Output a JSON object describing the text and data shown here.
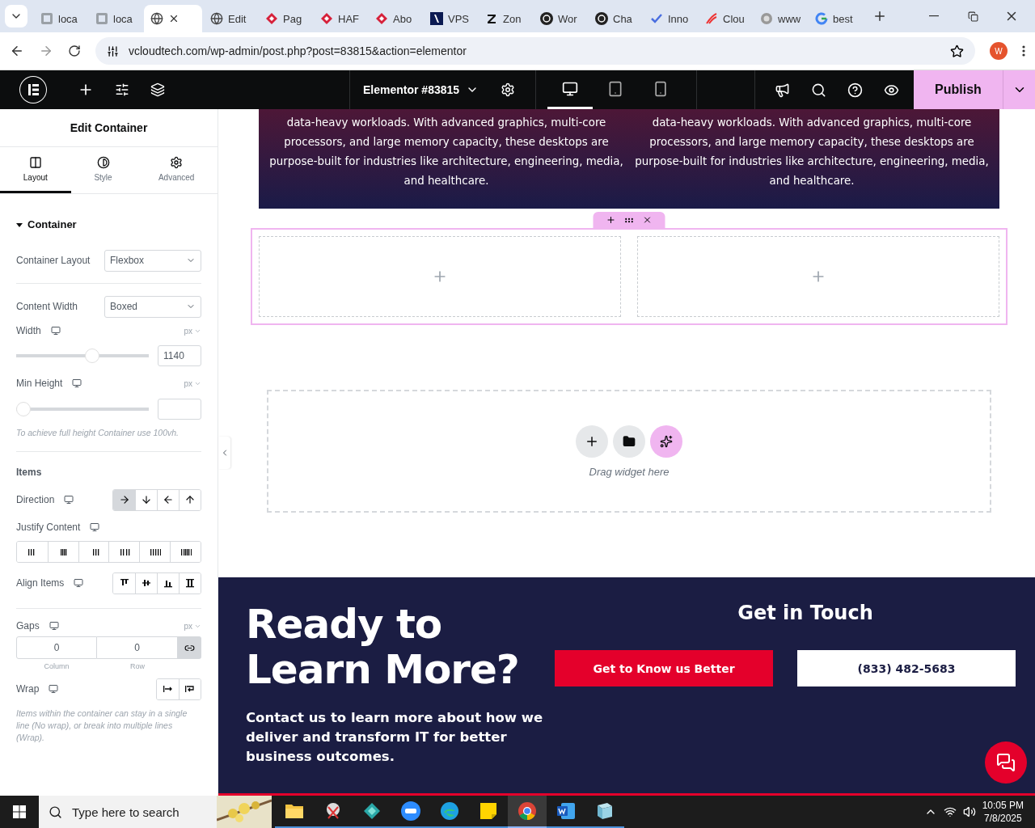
{
  "browser": {
    "tabs": [
      {
        "label": "loca",
        "kind": "page",
        "selected": false
      },
      {
        "label": "loca",
        "kind": "page",
        "selected": false
      },
      {
        "kind": "globe",
        "selected": true
      },
      {
        "label": "Edit",
        "kind": "globe",
        "selected": false
      },
      {
        "label": "Pag",
        "kind": "diamond",
        "selected": false
      },
      {
        "label": "HAF",
        "kind": "diamond",
        "selected": false
      },
      {
        "label": "Abo",
        "kind": "diamond",
        "selected": false
      },
      {
        "label": "VPS",
        "kind": "square",
        "selected": false
      },
      {
        "label": "Zon",
        "kind": "letter",
        "selected": false
      },
      {
        "label": "Wor",
        "kind": "ring",
        "selected": false
      },
      {
        "label": "Cha",
        "kind": "ring",
        "selected": false
      },
      {
        "label": "Inno",
        "kind": "check",
        "selected": false
      },
      {
        "label": "Clou",
        "kind": "swoosh",
        "selected": false
      },
      {
        "label": "www",
        "kind": "dot",
        "selected": false
      },
      {
        "label": "best",
        "kind": "g",
        "selected": false
      }
    ],
    "url": "vcloudtech.com/wp-admin/post.php?post=83815&action=elementor",
    "profile": "W"
  },
  "topbar": {
    "document_title": "Elementor #83815",
    "devices": [
      {
        "kind": "desktop",
        "selected": true
      },
      {
        "kind": "tablet",
        "selected": false
      },
      {
        "kind": "mobile",
        "selected": false
      }
    ],
    "publish": "Publish"
  },
  "panel": {
    "title": "Edit Container",
    "tabs": [
      {
        "label": "Layout",
        "kind": "layout",
        "selected": true
      },
      {
        "label": "Style",
        "kind": "style",
        "selected": false
      },
      {
        "label": "Advanced",
        "kind": "advanced",
        "selected": false
      }
    ],
    "section": {
      "title": "Container",
      "expanded": true
    },
    "container_layout": {
      "label": "Container Layout",
      "value": "Flexbox"
    },
    "content_width": {
      "label": "Content Width",
      "value": "Boxed"
    },
    "width": {
      "label": "Width",
      "unit": "px",
      "level": 0.58,
      "value": "1140"
    },
    "min_height": {
      "label": "Min Height",
      "unit": "px",
      "level": 0,
      "hint": "To achieve full height Container use 100vh."
    },
    "items_title": "Items",
    "direction": {
      "label": "Direction",
      "options": [
        {
          "kind": "right",
          "selected": true
        },
        {
          "kind": "down",
          "selected": false
        },
        {
          "kind": "left",
          "selected": false
        },
        {
          "kind": "up",
          "selected": false
        }
      ]
    },
    "justify": {
      "label": "Justify Content",
      "options": [
        {
          "kind": "start",
          "selected": false
        },
        {
          "kind": "center",
          "selected": false
        },
        {
          "kind": "end",
          "selected": false
        },
        {
          "kind": "between",
          "selected": false
        },
        {
          "kind": "around",
          "selected": false
        },
        {
          "kind": "evenly",
          "selected": false
        }
      ]
    },
    "align": {
      "label": "Align Items",
      "options": [
        {
          "kind": "start",
          "selected": false
        },
        {
          "kind": "center",
          "selected": false
        },
        {
          "kind": "end",
          "selected": false
        },
        {
          "kind": "stretch",
          "selected": false
        }
      ]
    },
    "gaps": {
      "label": "Gaps",
      "unit": "px",
      "column": "0",
      "row": "0",
      "column_label": "Column",
      "row_label": "Row",
      "linked": true
    },
    "wrap": {
      "label": "Wrap",
      "options": [
        {
          "kind": "nowrap",
          "selected": false
        },
        {
          "kind": "wrap",
          "selected": false
        }
      ],
      "hint": "Items within the container can stay in a single line (No wrap), or break into multiple lines (Wrap)."
    }
  },
  "canvas": {
    "banner_columns": [
      "data-heavy workloads. With advanced graphics, multi-core processors, and large memory capacity, these desktops are purpose-built for industries like architecture, engineering, media, and healthcare.",
      "data-heavy workloads. With advanced graphics, multi-core processors, and large memory capacity, these desktops are purpose-built for industries like architecture, engineering, media, and healthcare."
    ],
    "drop_hint": "Drag widget here",
    "footer": {
      "heading": "Ready to Learn More?",
      "text": "Contact us to learn more about how we deliver and transform IT for better business outcomes.",
      "side_title": "Get in Touch",
      "buttons": [
        {
          "label": "Get to Know us Better",
          "kind": "primary"
        },
        {
          "label": "(833) 482-5683",
          "kind": "outline"
        }
      ]
    }
  },
  "taskbar": {
    "search_placeholder": "Type here to search",
    "apps": [
      {
        "kind": "folder",
        "selected": false
      },
      {
        "kind": "snip",
        "selected": false
      },
      {
        "kind": "gem",
        "selected": false
      },
      {
        "kind": "zoom",
        "selected": false
      },
      {
        "kind": "edge",
        "selected": false
      },
      {
        "kind": "notes",
        "selected": false
      },
      {
        "kind": "chrome",
        "selected": true
      },
      {
        "kind": "word",
        "selected": false
      },
      {
        "kind": "book",
        "selected": false
      }
    ],
    "time": "10:05 PM",
    "date": "7/8/2025"
  }
}
